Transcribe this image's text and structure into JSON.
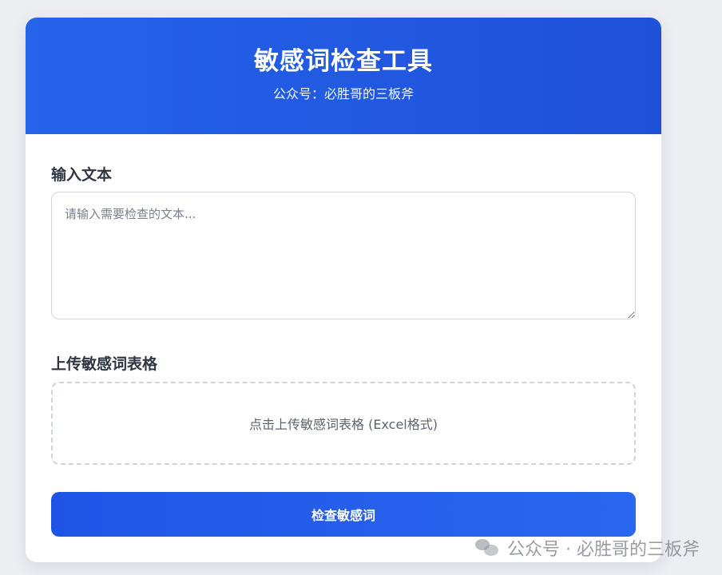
{
  "header": {
    "title": "敏感词检查工具",
    "subtitle": "公众号：必胜哥的三板斧"
  },
  "form": {
    "text_label": "输入文本",
    "text_placeholder": "请输入需要检查的文本...",
    "upload_label": "上传敏感词表格",
    "upload_prompt": "点击上传敏感词表格 (Excel格式)",
    "check_button_label": "检查敏感词"
  },
  "watermark": {
    "text": "公众号 · 必胜哥的三板斧",
    "icon": "wechat-icon"
  },
  "colors": {
    "header_gradient_start": "#2563eb",
    "header_gradient_end": "#1f50d8",
    "button_color": "#1f55e6",
    "background": "#eceef2"
  }
}
